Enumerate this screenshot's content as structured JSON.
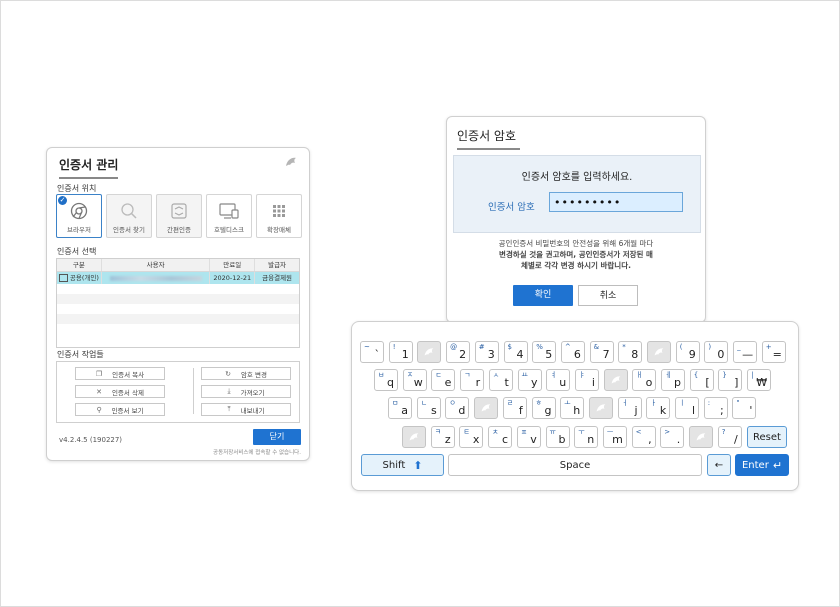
{
  "manager": {
    "title": "인증서 관리",
    "location_title": "인증서 위치",
    "locations": [
      "브라우저",
      "인증서 찾기",
      "간편인증",
      "호텔디스크",
      "확장매체"
    ],
    "select_title": "인증서 선택",
    "columns": [
      "구분",
      "사용자",
      "만료일",
      "발급자"
    ],
    "row": {
      "type": "공용(개인)",
      "expires": "2020-12-21",
      "issuer": "금융결제원"
    },
    "ops_title": "인증서 작업들",
    "ops": {
      "copy": "인증서 복사",
      "delete": "인증서 삭제",
      "view": "인증서 보기",
      "change_pw": "암호 변경",
      "import": "가져오기",
      "export": "내보내기"
    },
    "version": "v4.2.4.5 (190227)",
    "close": "닫기",
    "footer": "공동저장서비스에 접속할 수 없습니다."
  },
  "password": {
    "title": "인증서 암호",
    "prompt": "인증서 암호를 입력하세요.",
    "field_label": "인증서 암호",
    "value": "•••••••••",
    "notice_lines": [
      "공인인증서 비밀번호의 안전성을 위해 6개월 마다",
      "변경하실 것을 권고하며, 공인인증서가 저장된 매",
      "체별로 각각 변경 하시기 바랍니다."
    ],
    "ok": "확인",
    "cancel": "취소"
  },
  "keyboard": {
    "row1": [
      [
        "~",
        "`"
      ],
      [
        "!",
        "1"
      ],
      [
        "",
        ""
      ],
      [
        "@",
        "2"
      ],
      [
        "#",
        "3"
      ],
      [
        "$",
        "4"
      ],
      [
        "%",
        "5"
      ],
      [
        "^",
        "6"
      ],
      [
        "&",
        "7"
      ],
      [
        "*",
        "8"
      ],
      [
        "",
        ""
      ],
      [
        "(",
        "9"
      ],
      [
        ")",
        "0"
      ],
      [
        "_",
        "—"
      ],
      [
        "+",
        "="
      ]
    ],
    "row2": [
      [
        "ㅂ",
        "q"
      ],
      [
        "ㅈ",
        "w"
      ],
      [
        "ㄷ",
        "e"
      ],
      [
        "ㄱ",
        "r"
      ],
      [
        "ㅅ",
        "t"
      ],
      [
        "ㅛ",
        "y"
      ],
      [
        "ㅕ",
        "u"
      ],
      [
        "ㅑ",
        "i"
      ],
      [
        "",
        ""
      ],
      [
        "ㅐ",
        "o"
      ],
      [
        "ㅔ",
        "p"
      ],
      [
        "{",
        "["
      ],
      [
        "}",
        "]"
      ],
      [
        "|",
        "₩"
      ]
    ],
    "row3": [
      [
        "ㅁ",
        "a"
      ],
      [
        "ㄴ",
        "s"
      ],
      [
        "ㅇ",
        "d"
      ],
      [
        "",
        ""
      ],
      [
        "ㄹ",
        "f"
      ],
      [
        "ㅎ",
        "g"
      ],
      [
        "ㅗ",
        "h"
      ],
      [
        "",
        ""
      ],
      [
        "ㅓ",
        "j"
      ],
      [
        "ㅏ",
        "k"
      ],
      [
        "ㅣ",
        "l"
      ],
      [
        ":",
        ";"
      ],
      [
        "\"",
        "'"
      ]
    ],
    "row4": [
      [
        "",
        ""
      ],
      [
        "ㅋ",
        "z"
      ],
      [
        "ㅌ",
        "x"
      ],
      [
        "ㅊ",
        "c"
      ],
      [
        "ㅍ",
        "v"
      ],
      [
        "ㅠ",
        "b"
      ],
      [
        "ㅜ",
        "n"
      ],
      [
        "ㅡ",
        "m"
      ],
      [
        "<",
        ","
      ],
      [
        ">",
        "."
      ],
      [
        "",
        ""
      ],
      [
        "?",
        "/"
      ]
    ],
    "reset": "Reset",
    "shift": "Shift",
    "space": "Space",
    "back": "←",
    "enter": "Enter"
  }
}
